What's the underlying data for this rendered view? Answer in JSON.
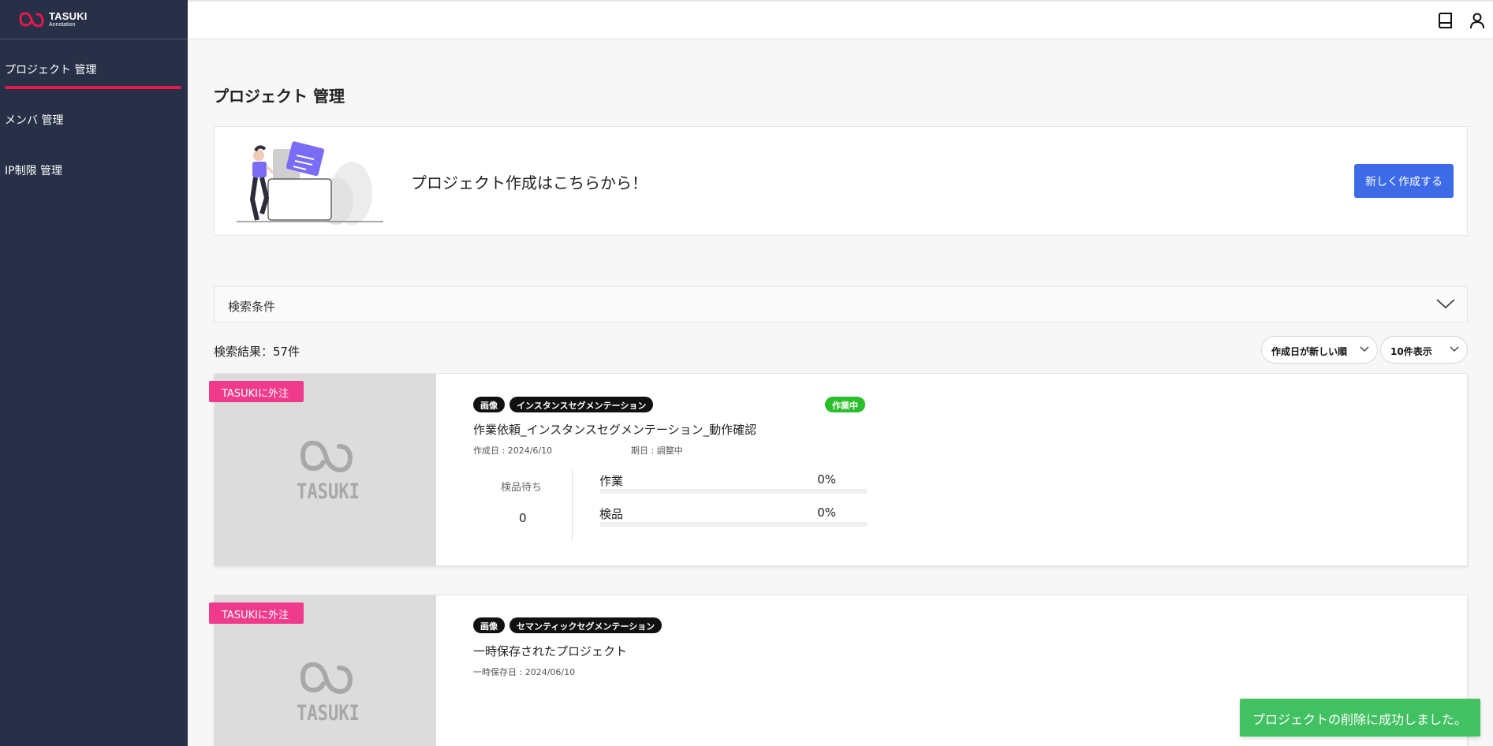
{
  "brand": {
    "name": "TASUKI",
    "sub": "Annotation"
  },
  "sidebar": {
    "items": [
      {
        "label": "プロジェクト 管理"
      },
      {
        "label": "メンバ 管理"
      },
      {
        "label": "IP制限 管理"
      }
    ]
  },
  "header": {
    "icons": [
      "book-icon",
      "user-icon"
    ]
  },
  "page": {
    "title": "プロジェクト 管理"
  },
  "create": {
    "message": "プロジェクト作成はこちらから！",
    "button_label": "新しく作成する"
  },
  "search": {
    "label": "検索条件"
  },
  "results": {
    "count_label": "検索結果：57件",
    "sort_value": "作成日が新しい順",
    "per_page_value": "10件表示"
  },
  "cards": [
    {
      "ribbon": "TASUKIに外注",
      "thumb_text": "TASUKI",
      "tags": [
        "画像",
        "インスタンスセグメンテーション"
      ],
      "status": "作業中",
      "title": "作業依頼_インスタンスセグメンテーション_動作確認",
      "created": "作成日 : 2024/6/10",
      "deadline": "期日 : 調整中",
      "pending_label": "検品待ち",
      "pending_value": "0",
      "progress": [
        {
          "label": "作業",
          "value_text": "0%",
          "percent": 0
        },
        {
          "label": "検品",
          "value_text": "0%",
          "percent": 0
        }
      ]
    },
    {
      "ribbon": "TASUKIに外注",
      "thumb_text": "TASUKI",
      "tags": [
        "画像",
        "セマンティックセグメンテーション"
      ],
      "title": "一時保存されたプロジェクト",
      "saved": "一時保存日 : 2024/06/10"
    }
  ],
  "toast": {
    "message": "プロジェクトの削除に成功しました。"
  },
  "colors": {
    "sidebar_bg": "#273047",
    "accent_red": "#e5194a",
    "primary_blue": "#3d6be8",
    "ribbon_pink": "#f03a8c",
    "status_green": "#2bbe2b",
    "toast_green": "#41c161"
  }
}
